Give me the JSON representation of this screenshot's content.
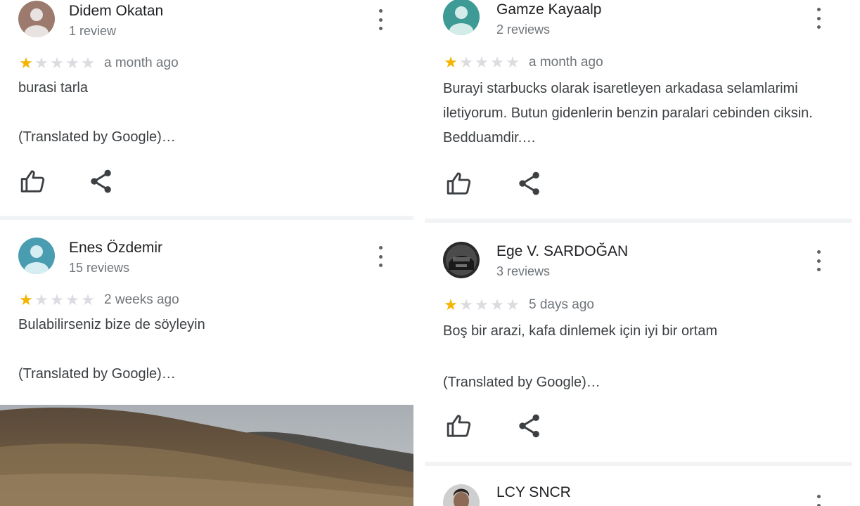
{
  "colors": {
    "star_filled": "#f4b400",
    "star_empty": "#dadce0",
    "avatar_brown": "#9c7b6e",
    "avatar_teal": "#3e9a95",
    "avatar_blue": "#4a9db0"
  },
  "left_column": {
    "reviews": [
      {
        "name": "Didem Okatan",
        "review_count": "1 review",
        "avatar": "default-person-avatar",
        "rating": 1,
        "time": "a month ago",
        "text": "burasi tarla",
        "translated": "(Translated by Google)…",
        "like_icon": "thumb-up-icon",
        "share_icon": "share-icon"
      },
      {
        "name": "Enes Özdemir",
        "review_count": "15 reviews",
        "avatar": "default-person-avatar",
        "rating": 1,
        "time": "2 weeks ago",
        "text": "Bulabilirseniz bize de söyleyin",
        "translated": "(Translated by Google)…",
        "photo": "hillside-landscape-photo"
      }
    ]
  },
  "right_column": {
    "reviews": [
      {
        "name": "Gamze Kayaalp",
        "review_count": "2 reviews",
        "avatar": "default-person-avatar",
        "rating": 1,
        "time": "a month ago",
        "text": "Burayi starbucks olarak isaretleyen arkadasa selamlarimi iletiyorum. Butun gidenlerin benzin paralari cebinden ciksin. Bedduamdir.…",
        "like_icon": "thumb-up-icon",
        "share_icon": "share-icon"
      },
      {
        "name": "Ege V. SARDOĞAN",
        "review_count": "3 reviews",
        "avatar": "photo-avatar",
        "rating": 1,
        "time": "5 days ago",
        "text": "Boş bir arazi, kafa dinlemek için iyi bir ortam",
        "translated": "(Translated by Google)…",
        "like_icon": "thumb-up-icon",
        "share_icon": "share-icon"
      },
      {
        "name": "LCY SNCR",
        "avatar": "photo-avatar"
      }
    ]
  }
}
